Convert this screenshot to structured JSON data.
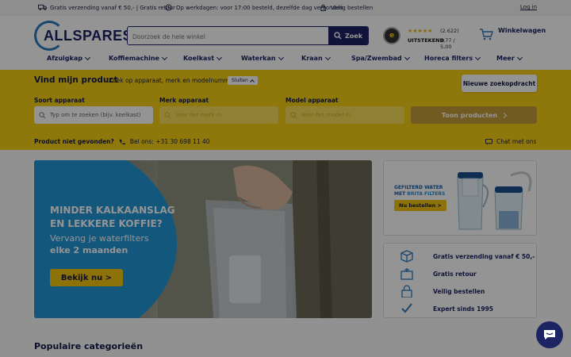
{
  "topbar": {
    "shipping": "Gratis verzending vanaf € 50,- | Gratis retour",
    "delivery": "Op werkdagen: voor 17:00 besteld, dezelfde dag verzonden",
    "secure": "Veilig bestellen",
    "login": "Log in"
  },
  "header": {
    "logo_text": "ALLSPARES",
    "search_placeholder": "Doorzoek de hele winkel",
    "search_button": "Zoek",
    "rating_count": "(2.622)",
    "rating_label": "UITSTEKEND",
    "rating_score": "4,77 / 5,00",
    "cart_label": "Winkelwagen"
  },
  "nav": {
    "items": [
      {
        "label": "Afzuigkap"
      },
      {
        "label": "Koffiemachine"
      },
      {
        "label": "Koelkast"
      },
      {
        "label": "Waterkan"
      },
      {
        "label": "Kraan"
      },
      {
        "label": "Spa/Zwembad"
      },
      {
        "label": "Horeca filters"
      },
      {
        "label": "Meer"
      }
    ]
  },
  "finder": {
    "title": "Vind mijn product",
    "subtitle": "Zoek op apparaat, merk en modelnummer",
    "close_label": "Sluiten",
    "new_search": "Nieuwe zoekopdracht",
    "device_label": "Soort apparaat",
    "device_placeholder": "Typ om te zoeken (bijv. koelkast)",
    "brand_label": "Merk apparaat",
    "brand_placeholder": "Voer het merk in",
    "model_label": "Model apparaat",
    "model_placeholder": "Voer het model in",
    "show_button": "Toon producten",
    "not_found": "Product niet gevonden?",
    "call": "Bel ons: +31 30 698 11 40",
    "chat": "Chat met ons"
  },
  "hero": {
    "line1": "MINDER KALKAANSLAG",
    "line2": "EN LEKKERE KOFFIE?",
    "line3": "Vervang je waterfilters",
    "line4": "elke 2 maanden",
    "cta": "Bekijk nu >"
  },
  "brita": {
    "line1": "GEFILTERD WATER",
    "line2_prefix": "MET ",
    "line2_brand": "BRITA FILTERS",
    "cta": "Nu bestellen >"
  },
  "usps": [
    {
      "label": "Gratis verzending vanaf € 50,-",
      "icon": "box-icon"
    },
    {
      "label": "Gratis retour",
      "icon": "return-icon"
    },
    {
      "label": "Veilig bestellen",
      "icon": "lock-icon"
    },
    {
      "label": "Expert sinds 1995",
      "icon": "check-icon"
    }
  ],
  "popular_title": "Populaire categorieën",
  "colors": {
    "brand_navy": "#1d2464",
    "accent_yellow": "#f5cf14",
    "hero_blue": "#2196d8"
  }
}
